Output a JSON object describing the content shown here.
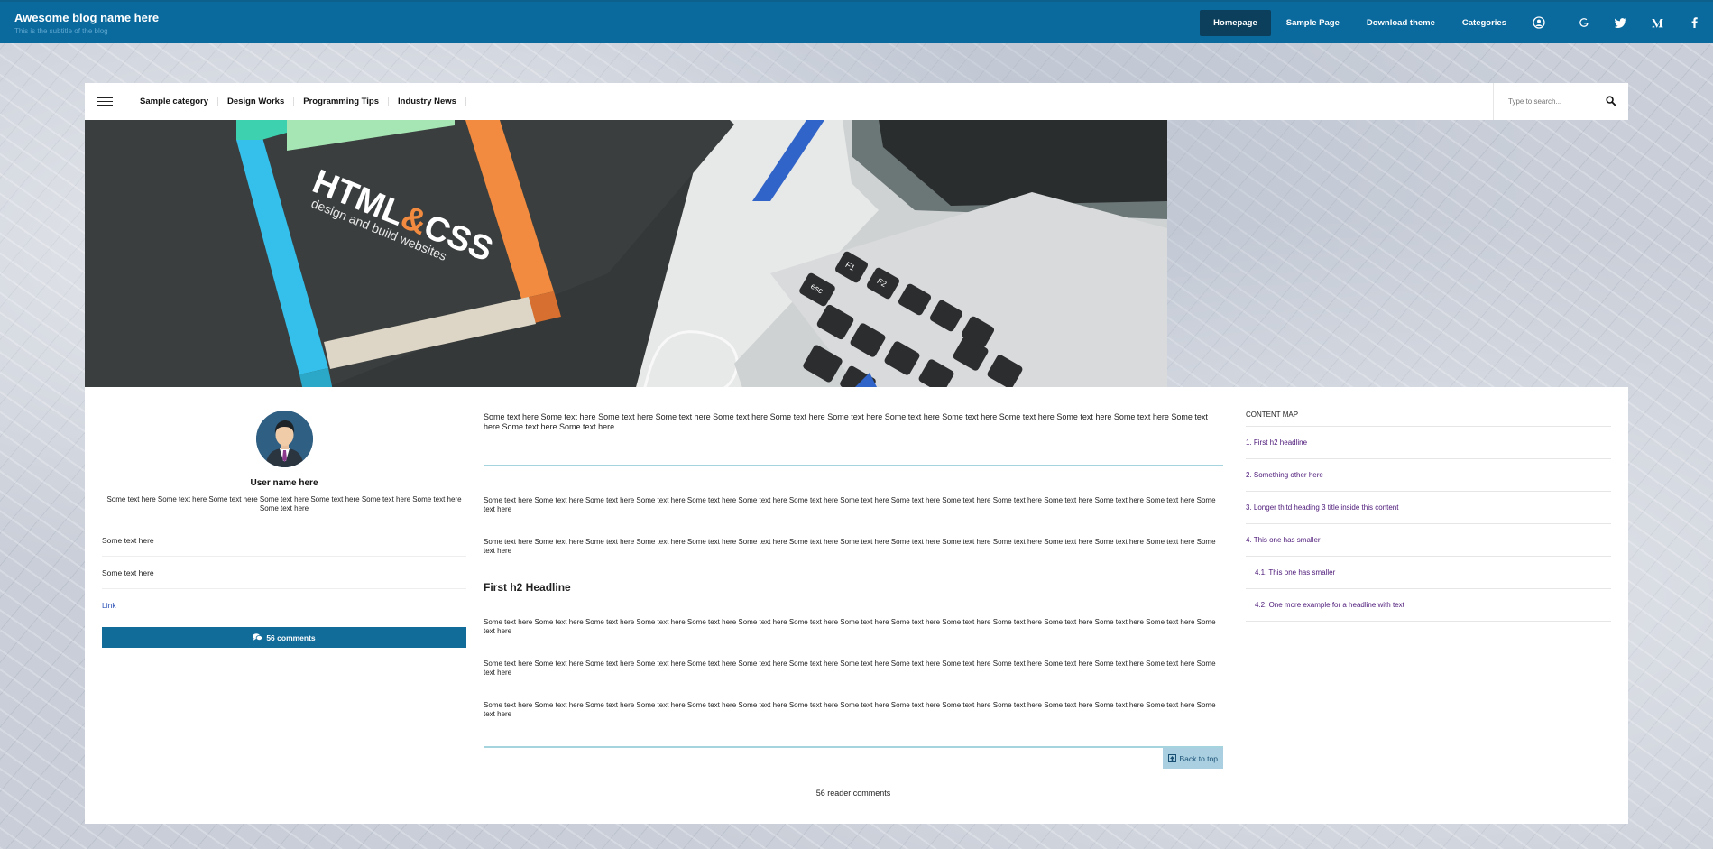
{
  "header": {
    "title": "Awesome blog name here",
    "subtitle": "This is the subtitle of the blog",
    "nav": [
      "Homepage",
      "Sample Page",
      "Download theme",
      "Categories"
    ],
    "active": "Homepage"
  },
  "secondary_nav": {
    "categories": [
      "Sample category",
      "Design Works",
      "Programming Tips",
      "Industry News"
    ],
    "search_placeholder": "Type to search..."
  },
  "hero": {
    "book_title_part1": "HTML",
    "book_title_amp": "&",
    "book_title_part2": "CSS",
    "book_subtitle": "design and build websites",
    "key_esc": "esc",
    "key_f1": "F1",
    "key_f2": "F2"
  },
  "author": {
    "name": "User name here",
    "bio": "Some text here Some text here Some text here Some text here Some text here Some text here Some text here Some text here",
    "rows": [
      "Some text here",
      "Some text here"
    ],
    "link": "Link",
    "comments_button": "56 comments"
  },
  "article": {
    "lead": "Some text here Some text here Some text here Some text here Some text here Some text here Some text here Some text here Some text here Some text here Some text here Some text here Some text here Some text here Some text here",
    "paragraphs_before": [
      "Some text here Some text here Some text here Some text here Some text here Some text here Some text here Some text here Some text here Some text here Some text here Some text here Some text here Some text here Some text here",
      "Some text here Some text here Some text here Some text here Some text here Some text here Some text here Some text here Some text here Some text here Some text here Some text here Some text here Some text here Some text here"
    ],
    "h2": "First h2 Headline",
    "paragraphs_after": [
      "Some text here Some text here Some text here Some text here Some text here Some text here Some text here Some text here Some text here Some text here Some text here Some text here Some text here Some text here Some text here",
      "Some text here Some text here Some text here Some text here Some text here Some text here Some text here Some text here Some text here Some text here Some text here Some text here Some text here Some text here Some text here",
      "Some text here Some text here Some text here Some text here Some text here Some text here Some text here Some text here Some text here Some text here Some text here Some text here Some text here Some text here Some text here"
    ],
    "back_to_top": "Back to top",
    "reader_comments": "56 reader comments"
  },
  "content_map": {
    "title": "CONTENT MAP",
    "items": [
      {
        "label": "1. First h2 headline",
        "level": 1
      },
      {
        "label": "2. Something other here",
        "level": 1
      },
      {
        "label": "3. Longer thitd heading 3 title inside this content",
        "level": 1
      },
      {
        "label": "4. This one has smaller",
        "level": 1
      },
      {
        "label": "4.1. This one has smaller",
        "level": 2
      },
      {
        "label": "4.2. One more example for a headline with text",
        "level": 2
      }
    ]
  },
  "colors": {
    "header_bg": "#0a6a9e",
    "active_nav_bg": "#0b3f5c",
    "accent_button": "#126c9a",
    "toc_link": "#4b1778",
    "divider": "#a5d3de"
  }
}
